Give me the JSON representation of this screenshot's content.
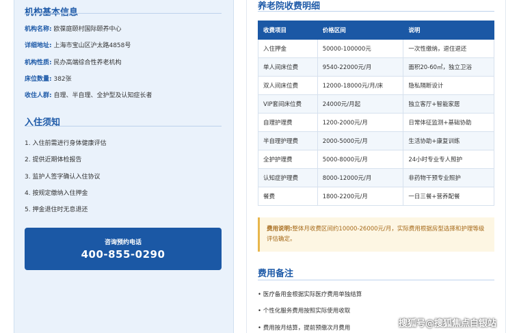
{
  "basic_info": {
    "title": "机构基本信息",
    "rows": [
      {
        "label": "机构名称:",
        "value": "欧葆庭颐村国际颐养中心"
      },
      {
        "label": "详细地址:",
        "value": "上海市宝山区沪太路4858号"
      },
      {
        "label": "机构性质:",
        "value": "民办高端综合性养老机构"
      },
      {
        "label": "床位数量:",
        "value": "382张"
      },
      {
        "label": "收住人群:",
        "value": "自理、半自理、全护型及认知症长者"
      }
    ]
  },
  "notice": {
    "title": "入住须知",
    "items": [
      "1. 入住前需进行身体健康评估",
      "2. 提供近期体检报告",
      "3. 监护人签字确认入住协议",
      "4. 按规定缴纳入住押金",
      "5. 押金退住时无息退还"
    ]
  },
  "phone": {
    "label": "咨询预约电话",
    "number": "400-855-0290"
  },
  "fees": {
    "title": "养老院收费明细",
    "headers": [
      "收费项目",
      "价格区间",
      "说明"
    ],
    "rows": [
      [
        "入住押金",
        "50000-100000元",
        "一次性缴纳，退住退还"
      ],
      [
        "单人间床位费",
        "9540-22000元/月",
        "面积20-60㎡，独立卫浴"
      ],
      [
        "双人间床位费",
        "12000-18000元/月/床",
        "隐私隔断设计"
      ],
      [
        "VIP套间床位费",
        "24000元/月起",
        "独立客厅+智能家居"
      ],
      [
        "自理护理费",
        "1200-2000元/月",
        "日常体征监测+基础协助"
      ],
      [
        "半自理护理费",
        "2000-5000元/月",
        "生活协助+康复训练"
      ],
      [
        "全护护理费",
        "5000-8000元/月",
        "24小时专业专人照护"
      ],
      [
        "认知症护理费",
        "8000-12000元/月",
        "非药物干预专业照护"
      ],
      [
        "餐费",
        "1800-2200元/月",
        "一日三餐+营养配餐"
      ]
    ],
    "note_label": "费用说明:",
    "note_text": "整体月收费区间约10000-26000元/月，实际费用根据房型选择和护理等级评估确定。"
  },
  "remarks": {
    "title": "费用备注",
    "items": [
      "• 医疗备用金根据实际医疗费用单独结算",
      "• 个性化服务费用按照实际使用收取",
      "• 费用按月结算，提前预缴次月费用"
    ]
  },
  "watermark": "搜狐号@搜狐焦点白银站",
  "colors": {
    "accent": "#1b58a5",
    "panel_bg": "#eaf2fb",
    "note_bg": "#fdf6e3"
  }
}
